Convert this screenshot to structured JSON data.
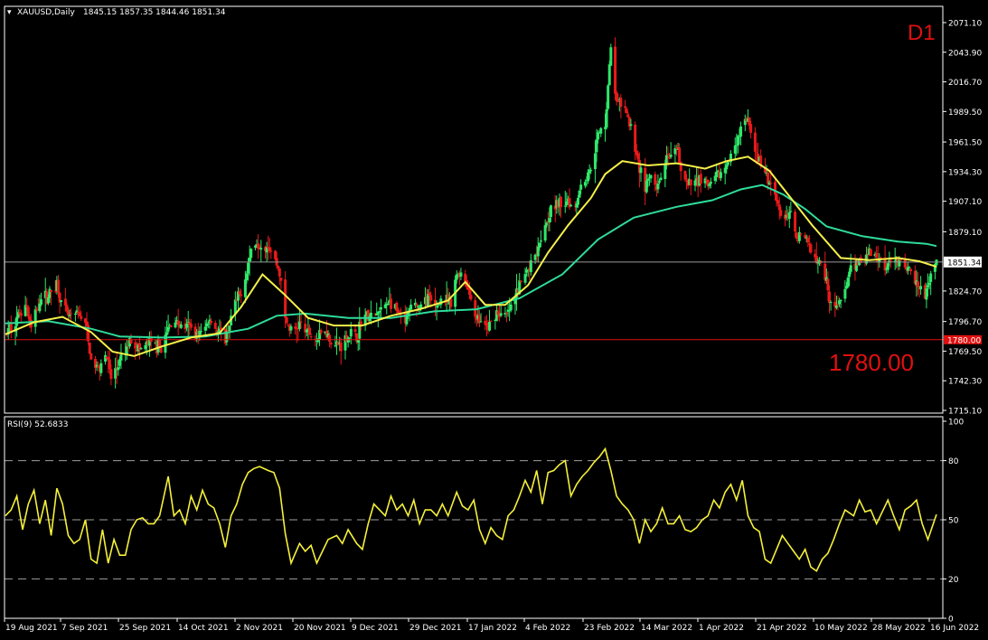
{
  "header": {
    "symbol": "XAUUSD,Daily",
    "ohlc": "1845.15 1857.35 1844.46 1851.34",
    "timeframe": "D1",
    "level_annotation": "1780.00"
  },
  "colors": {
    "background": "#000000",
    "bull_candle": "#2ee86a",
    "bear_candle": "#e81a1a",
    "ma_fast": "#f5f04a",
    "ma_slow": "#2edc9a",
    "price_line": "#9a9a9a",
    "level_line": "#e01010",
    "rsi_line": "#f5f03a",
    "frame": "#ffffff",
    "level_text": "#e01010"
  },
  "chart_data": [
    {
      "type": "candlestick",
      "title": "XAUUSD,Daily",
      "ylim": [
        1715.1,
        2071.1
      ],
      "y_ticks": [
        "2071.10",
        "2043.90",
        "2016.70",
        "1989.50",
        "1961.50",
        "1934.30",
        "1907.10",
        "1879.10",
        "1851.34",
        "1824.70",
        "1796.70",
        "1780.00",
        "1769.50",
        "1742.30",
        "1715.10"
      ],
      "x_ticks": [
        "19 Aug 2021",
        "7 Sep 2021",
        "25 Sep 2021",
        "14 Oct 2021",
        "2 Nov 2021",
        "20 Nov 2021",
        "9 Dec 2021",
        "29 Dec 2021",
        "17 Jan 2022",
        "4 Feb 2022",
        "23 Feb 2022",
        "14 Mar 2022",
        "1 Apr 2022",
        "21 Apr 2022",
        "10 May 2022",
        "28 May 2022",
        "16 Jun 2022"
      ],
      "current_price": "1851.34",
      "horizontal_level": "1780.00",
      "close_path": [
        [
          0,
          1784
        ],
        [
          8,
          1800
        ],
        [
          14,
          1815
        ],
        [
          18,
          1790
        ],
        [
          24,
          1817
        ],
        [
          30,
          1820
        ],
        [
          36,
          1832
        ],
        [
          40,
          1808
        ],
        [
          45,
          1800
        ],
        [
          52,
          1803
        ],
        [
          56,
          1796
        ],
        [
          60,
          1760
        ],
        [
          65,
          1753
        ],
        [
          70,
          1770
        ],
        [
          74,
          1744
        ],
        [
          79,
          1756
        ],
        [
          84,
          1768
        ],
        [
          88,
          1782
        ],
        [
          94,
          1770
        ],
        [
          100,
          1776
        ],
        [
          106,
          1774
        ],
        [
          110,
          1772
        ],
        [
          114,
          1790
        ],
        [
          118,
          1800
        ],
        [
          122,
          1793
        ],
        [
          128,
          1792
        ],
        [
          134,
          1786
        ],
        [
          138,
          1786
        ],
        [
          143,
          1800
        ],
        [
          148,
          1788
        ],
        [
          154,
          1780
        ],
        [
          160,
          1810
        ],
        [
          164,
          1820
        ],
        [
          168,
          1838
        ],
        [
          172,
          1862
        ],
        [
          176,
          1870
        ],
        [
          180,
          1867
        ],
        [
          184,
          1868
        ],
        [
          188,
          1856
        ],
        [
          192,
          1842
        ],
        [
          196,
          1798
        ],
        [
          201,
          1785
        ],
        [
          206,
          1795
        ],
        [
          212,
          1786
        ],
        [
          218,
          1780
        ],
        [
          224,
          1790
        ],
        [
          230,
          1774
        ],
        [
          236,
          1777
        ],
        [
          242,
          1786
        ],
        [
          246,
          1780
        ],
        [
          250,
          1803
        ],
        [
          256,
          1800
        ],
        [
          262,
          1805
        ],
        [
          268,
          1816
        ],
        [
          274,
          1805
        ],
        [
          280,
          1795
        ],
        [
          286,
          1816
        ],
        [
          290,
          1808
        ],
        [
          296,
          1820
        ],
        [
          300,
          1805
        ],
        [
          306,
          1820
        ],
        [
          312,
          1810
        ],
        [
          316,
          1840
        ],
        [
          320,
          1843
        ],
        [
          324,
          1826
        ],
        [
          330,
          1800
        ],
        [
          334,
          1795
        ],
        [
          338,
          1790
        ],
        [
          344,
          1806
        ],
        [
          350,
          1800
        ],
        [
          356,
          1815
        ],
        [
          362,
          1836
        ],
        [
          370,
          1855
        ],
        [
          376,
          1880
        ],
        [
          382,
          1900
        ],
        [
          388,
          1904
        ],
        [
          394,
          1910
        ],
        [
          398,
          1898
        ],
        [
          404,
          1927
        ],
        [
          408,
          1930
        ],
        [
          412,
          1952
        ],
        [
          416,
          1970
        ],
        [
          420,
          1980
        ],
        [
          424,
          2047
        ],
        [
          428,
          1997
        ],
        [
          432,
          1996
        ],
        [
          436,
          1982
        ],
        [
          440,
          1965
        ],
        [
          444,
          1938
        ],
        [
          448,
          1920
        ],
        [
          452,
          1930
        ],
        [
          456,
          1915
        ],
        [
          462,
          1944
        ],
        [
          466,
          1944
        ],
        [
          470,
          1955
        ],
        [
          474,
          1934
        ],
        [
          478,
          1920
        ],
        [
          482,
          1924
        ],
        [
          488,
          1930
        ],
        [
          492,
          1920
        ],
        [
          496,
          1925
        ],
        [
          500,
          1932
        ],
        [
          504,
          1937
        ],
        [
          508,
          1947
        ],
        [
          512,
          1965
        ],
        [
          516,
          1975
        ],
        [
          520,
          1982
        ],
        [
          524,
          1952
        ],
        [
          528,
          1945
        ],
        [
          532,
          1930
        ],
        [
          538,
          1920
        ],
        [
          544,
          1890
        ],
        [
          550,
          1895
        ],
        [
          554,
          1876
        ],
        [
          558,
          1878
        ],
        [
          562,
          1868
        ],
        [
          566,
          1860
        ],
        [
          570,
          1855
        ],
        [
          574,
          1840
        ],
        [
          578,
          1815
        ],
        [
          582,
          1808
        ],
        [
          586,
          1820
        ],
        [
          590,
          1835
        ],
        [
          596,
          1852
        ],
        [
          602,
          1855
        ],
        [
          606,
          1862
        ],
        [
          612,
          1855
        ],
        [
          616,
          1848
        ],
        [
          622,
          1857
        ],
        [
          628,
          1850
        ],
        [
          632,
          1844
        ],
        [
          636,
          1836
        ],
        [
          640,
          1830
        ],
        [
          644,
          1817
        ],
        [
          648,
          1838
        ],
        [
          652,
          1851
        ]
      ],
      "ma_fast_path": [
        [
          0,
          1785
        ],
        [
          20,
          1796
        ],
        [
          40,
          1801
        ],
        [
          60,
          1787
        ],
        [
          75,
          1769
        ],
        [
          90,
          1765
        ],
        [
          110,
          1774
        ],
        [
          130,
          1782
        ],
        [
          150,
          1786
        ],
        [
          165,
          1810
        ],
        [
          180,
          1840
        ],
        [
          195,
          1822
        ],
        [
          212,
          1800
        ],
        [
          230,
          1793
        ],
        [
          250,
          1793
        ],
        [
          270,
          1802
        ],
        [
          290,
          1808
        ],
        [
          310,
          1816
        ],
        [
          322,
          1833
        ],
        [
          336,
          1812
        ],
        [
          350,
          1812
        ],
        [
          366,
          1830
        ],
        [
          380,
          1860
        ],
        [
          394,
          1885
        ],
        [
          410,
          1910
        ],
        [
          420,
          1932
        ],
        [
          432,
          1944
        ],
        [
          450,
          1940
        ],
        [
          470,
          1942
        ],
        [
          490,
          1937
        ],
        [
          505,
          1944
        ],
        [
          520,
          1948
        ],
        [
          535,
          1935
        ],
        [
          550,
          1910
        ],
        [
          565,
          1885
        ],
        [
          585,
          1855
        ],
        [
          605,
          1853
        ],
        [
          625,
          1855
        ],
        [
          640,
          1852
        ],
        [
          652,
          1847
        ]
      ],
      "ma_slow_path": [
        [
          0,
          1795
        ],
        [
          30,
          1797
        ],
        [
          60,
          1790
        ],
        [
          80,
          1783
        ],
        [
          110,
          1782
        ],
        [
          140,
          1783
        ],
        [
          170,
          1790
        ],
        [
          190,
          1802
        ],
        [
          210,
          1804
        ],
        [
          240,
          1800
        ],
        [
          270,
          1800
        ],
        [
          300,
          1806
        ],
        [
          330,
          1808
        ],
        [
          360,
          1818
        ],
        [
          390,
          1840
        ],
        [
          415,
          1872
        ],
        [
          440,
          1892
        ],
        [
          470,
          1902
        ],
        [
          495,
          1908
        ],
        [
          515,
          1918
        ],
        [
          530,
          1922
        ],
        [
          545,
          1913
        ],
        [
          560,
          1900
        ],
        [
          575,
          1884
        ],
        [
          600,
          1875
        ],
        [
          625,
          1870
        ],
        [
          645,
          1868
        ],
        [
          652,
          1866
        ]
      ]
    },
    {
      "type": "line",
      "title": "RSI(9) 52.6833",
      "ylim": [
        0,
        100
      ],
      "y_ticks": [
        "100",
        "80",
        "50",
        "20",
        "0"
      ],
      "levels": [
        80,
        50,
        20
      ],
      "path": [
        [
          0,
          52
        ],
        [
          4,
          55
        ],
        [
          8,
          62
        ],
        [
          12,
          45
        ],
        [
          16,
          58
        ],
        [
          20,
          65
        ],
        [
          24,
          48
        ],
        [
          28,
          60
        ],
        [
          32,
          42
        ],
        [
          36,
          66
        ],
        [
          40,
          58
        ],
        [
          44,
          42
        ],
        [
          48,
          38
        ],
        [
          52,
          40
        ],
        [
          56,
          50
        ],
        [
          60,
          30
        ],
        [
          64,
          28
        ],
        [
          68,
          45
        ],
        [
          72,
          28
        ],
        [
          76,
          40
        ],
        [
          80,
          32
        ],
        [
          84,
          32
        ],
        [
          88,
          45
        ],
        [
          92,
          50
        ],
        [
          96,
          51
        ],
        [
          100,
          48
        ],
        [
          104,
          48
        ],
        [
          108,
          52
        ],
        [
          114,
          72
        ],
        [
          118,
          52
        ],
        [
          122,
          55
        ],
        [
          126,
          48
        ],
        [
          130,
          62
        ],
        [
          134,
          55
        ],
        [
          138,
          65
        ],
        [
          142,
          58
        ],
        [
          146,
          56
        ],
        [
          150,
          48
        ],
        [
          154,
          36
        ],
        [
          158,
          52
        ],
        [
          162,
          58
        ],
        [
          166,
          68
        ],
        [
          170,
          74
        ],
        [
          174,
          76
        ],
        [
          178,
          77
        ],
        [
          184,
          75
        ],
        [
          188,
          74
        ],
        [
          192,
          66
        ],
        [
          196,
          43
        ],
        [
          200,
          28
        ],
        [
          206,
          38
        ],
        [
          210,
          34
        ],
        [
          214,
          37
        ],
        [
          218,
          28
        ],
        [
          222,
          34
        ],
        [
          226,
          40
        ],
        [
          232,
          42
        ],
        [
          236,
          38
        ],
        [
          240,
          45
        ],
        [
          246,
          38
        ],
        [
          250,
          35
        ],
        [
          254,
          48
        ],
        [
          258,
          58
        ],
        [
          262,
          55
        ],
        [
          266,
          52
        ],
        [
          270,
          62
        ],
        [
          274,
          55
        ],
        [
          278,
          58
        ],
        [
          282,
          52
        ],
        [
          286,
          60
        ],
        [
          290,
          48
        ],
        [
          294,
          55
        ],
        [
          298,
          55
        ],
        [
          302,
          52
        ],
        [
          306,
          58
        ],
        [
          310,
          52
        ],
        [
          316,
          64
        ],
        [
          320,
          57
        ],
        [
          324,
          55
        ],
        [
          328,
          60
        ],
        [
          332,
          45
        ],
        [
          336,
          38
        ],
        [
          340,
          46
        ],
        [
          344,
          42
        ],
        [
          348,
          40
        ],
        [
          352,
          52
        ],
        [
          356,
          55
        ],
        [
          360,
          62
        ],
        [
          364,
          70
        ],
        [
          368,
          64
        ],
        [
          372,
          75
        ],
        [
          376,
          58
        ],
        [
          380,
          74
        ],
        [
          384,
          75
        ],
        [
          388,
          78
        ],
        [
          392,
          80
        ],
        [
          396,
          62
        ],
        [
          400,
          68
        ],
        [
          404,
          72
        ],
        [
          408,
          75
        ],
        [
          412,
          79
        ],
        [
          416,
          82
        ],
        [
          420,
          86
        ],
        [
          424,
          75
        ],
        [
          428,
          62
        ],
        [
          432,
          58
        ],
        [
          436,
          55
        ],
        [
          440,
          50
        ],
        [
          444,
          38
        ],
        [
          448,
          50
        ],
        [
          452,
          44
        ],
        [
          456,
          48
        ],
        [
          460,
          56
        ],
        [
          464,
          48
        ],
        [
          468,
          48
        ],
        [
          472,
          52
        ],
        [
          476,
          45
        ],
        [
          480,
          44
        ],
        [
          484,
          46
        ],
        [
          488,
          50
        ],
        [
          492,
          52
        ],
        [
          496,
          60
        ],
        [
          500,
          56
        ],
        [
          504,
          64
        ],
        [
          508,
          68
        ],
        [
          512,
          60
        ],
        [
          516,
          70
        ],
        [
          520,
          52
        ],
        [
          524,
          46
        ],
        [
          528,
          44
        ],
        [
          532,
          30
        ],
        [
          536,
          28
        ],
        [
          540,
          35
        ],
        [
          544,
          42
        ],
        [
          548,
          38
        ],
        [
          552,
          34
        ],
        [
          556,
          30
        ],
        [
          560,
          35
        ],
        [
          564,
          26
        ],
        [
          568,
          24
        ],
        [
          572,
          30
        ],
        [
          576,
          33
        ],
        [
          580,
          40
        ],
        [
          584,
          48
        ],
        [
          588,
          55
        ],
        [
          594,
          52
        ],
        [
          598,
          60
        ],
        [
          602,
          54
        ],
        [
          606,
          55
        ],
        [
          610,
          48
        ],
        [
          614,
          54
        ],
        [
          618,
          60
        ],
        [
          622,
          52
        ],
        [
          626,
          45
        ],
        [
          630,
          55
        ],
        [
          634,
          57
        ],
        [
          638,
          60
        ],
        [
          642,
          48
        ],
        [
          646,
          40
        ],
        [
          652,
          52.7
        ]
      ]
    }
  ]
}
